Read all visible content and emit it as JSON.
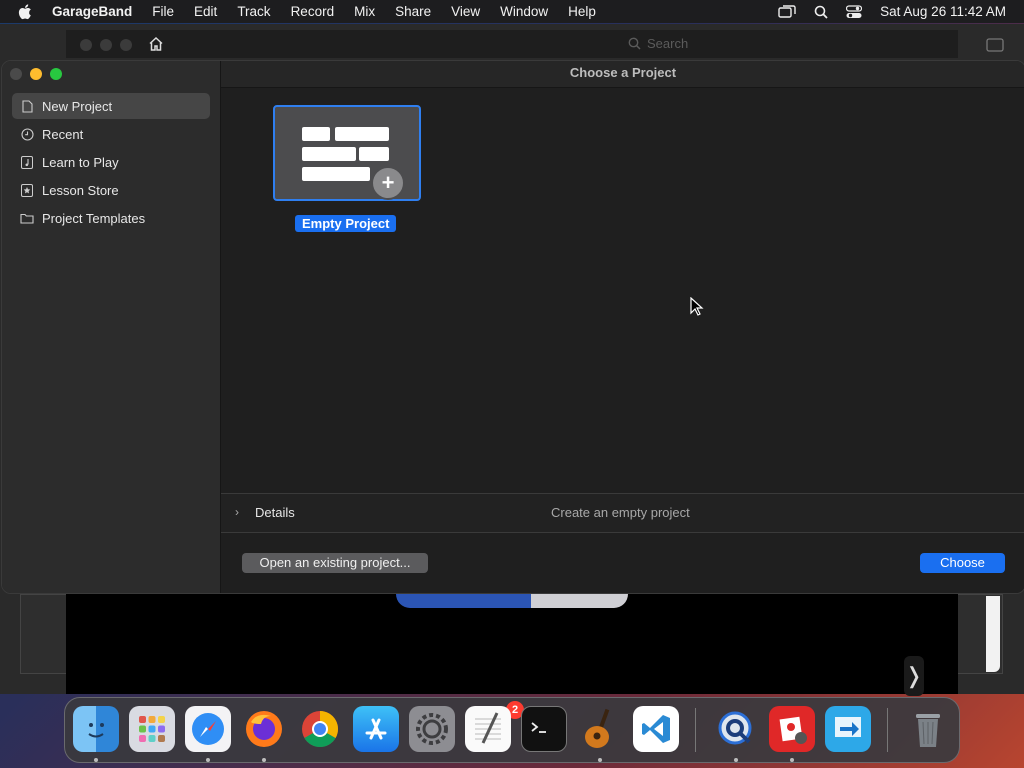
{
  "menubar": {
    "app_name": "GarageBand",
    "menus": [
      "File",
      "Edit",
      "Track",
      "Record",
      "Mix",
      "Share",
      "View",
      "Window",
      "Help"
    ],
    "clock": "Sat Aug 26  11:42 AM"
  },
  "background_window": {
    "search_placeholder": "Search"
  },
  "dialog": {
    "title": "Choose a Project",
    "sidebar": [
      {
        "label": "New Project",
        "icon": "document-icon",
        "selected": true
      },
      {
        "label": "Recent",
        "icon": "clock-icon"
      },
      {
        "label": "Learn to Play",
        "icon": "music-note-icon"
      },
      {
        "label": "Lesson Store",
        "icon": "star-icon"
      },
      {
        "label": "Project Templates",
        "icon": "folder-icon"
      }
    ],
    "project_tile": {
      "label": "Empty Project",
      "selected": true
    },
    "details": {
      "label": "Details",
      "description": "Create an empty project"
    },
    "buttons": {
      "open_existing": "Open an existing project...",
      "choose": "Choose"
    }
  },
  "dock": {
    "apps": [
      "Finder",
      "Launchpad",
      "Safari",
      "Firefox",
      "Chrome",
      "App Store",
      "System Settings",
      "TextEdit",
      "Terminal",
      "GarageBand",
      "Visual Studio Code",
      "QuickTime Player",
      "Photo Booth",
      "Migration Assistant",
      "Trash"
    ],
    "settings_badge": "2"
  },
  "colors": {
    "accent": "#1a6ff0",
    "window_bg": "#1f1f1f",
    "sidebar_bg": "#2c2c2c"
  }
}
